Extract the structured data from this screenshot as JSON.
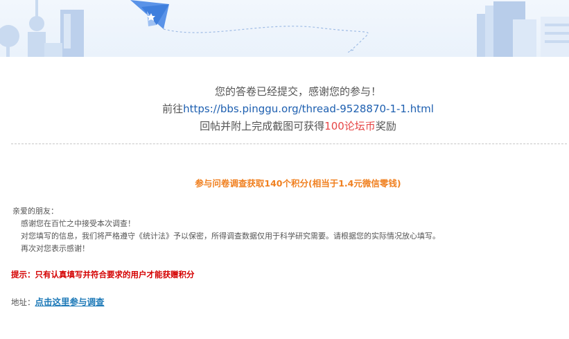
{
  "banner": {
    "colors": {
      "background": "#eef4fc",
      "shape": "#c7d8ef",
      "plane": "#5a93e8"
    },
    "icons": [
      "city-skyline-icon",
      "paper-plane-icon",
      "books-icon"
    ]
  },
  "thanks": {
    "line1": "您的答卷已经提交，感谢您的参与！",
    "line2_prefix": "前往",
    "line2_url": "https://bbs.pinggu.org/thread-9528870-1-1.html",
    "line3_prefix": "回帖并附上完成截图可获得",
    "line3_highlight": "100论坛币",
    "line3_suffix": "奖励"
  },
  "promo": {
    "points_title": "参与问卷调查获取140个积分(相当于1.4元微信零钱)"
  },
  "letter": {
    "greeting": "亲爱的朋友：",
    "line1": "感谢您在百忙之中接受本次调查！",
    "line2": "对您填写的信息，我们将严格遵守《统计法》予以保密，所得调查数据仅用于科学研究需要。请根据您的实际情况放心填写。",
    "line3": "再次对您表示感谢！"
  },
  "tip": {
    "text": "提示：只有认真填写并符合要求的用户才能获赠积分"
  },
  "address": {
    "label": "地址：",
    "link_text": "点击这里参与调查"
  }
}
